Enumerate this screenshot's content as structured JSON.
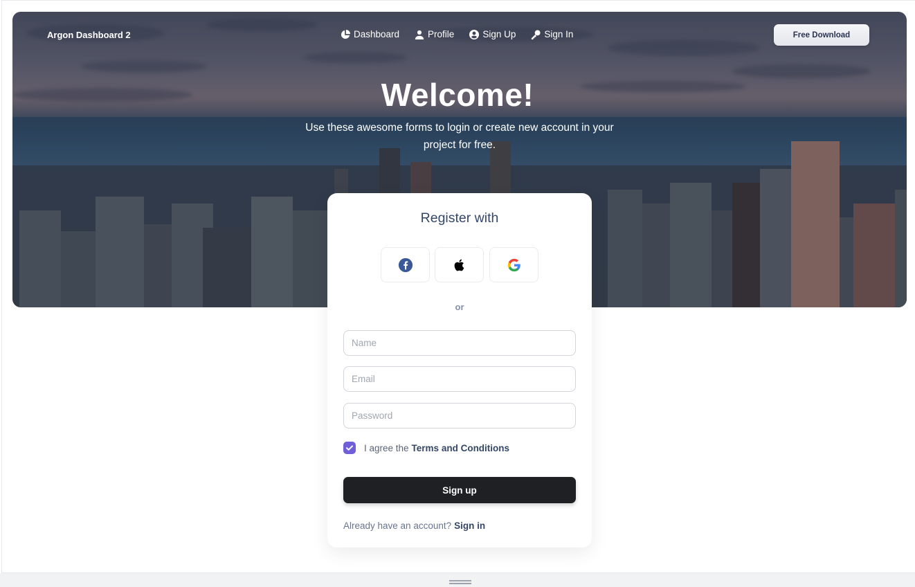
{
  "navbar": {
    "brand": "Argon Dashboard 2",
    "items": [
      {
        "label": "Dashboard",
        "icon": "pie-chart-icon"
      },
      {
        "label": "Profile",
        "icon": "user-icon"
      },
      {
        "label": "Sign Up",
        "icon": "user-circle-icon"
      },
      {
        "label": "Sign In",
        "icon": "key-icon"
      }
    ],
    "download_label": "Free Download"
  },
  "hero": {
    "title": "Welcome!",
    "subtitle": "Use these awesome forms to login or create new account in your project for free."
  },
  "card": {
    "title": "Register with",
    "social": [
      {
        "name": "facebook",
        "icon": "facebook-icon",
        "color": "#3b5998"
      },
      {
        "name": "apple",
        "icon": "apple-icon",
        "color": "#000000"
      },
      {
        "name": "google",
        "icon": "google-icon",
        "color": "#4285F4"
      }
    ],
    "divider": "or",
    "fields": {
      "name_placeholder": "Name",
      "email_placeholder": "Email",
      "password_placeholder": "Password"
    },
    "agree_prefix": "I agree the",
    "terms_label": "Terms and Conditions",
    "agree_checked": true,
    "submit_label": "Sign up",
    "already_text": "Already have an account?",
    "signin_label": "Sign in"
  },
  "colors": {
    "accent": "#6f5fd9",
    "primary_dark": "#1f2024",
    "text": "#344767"
  }
}
